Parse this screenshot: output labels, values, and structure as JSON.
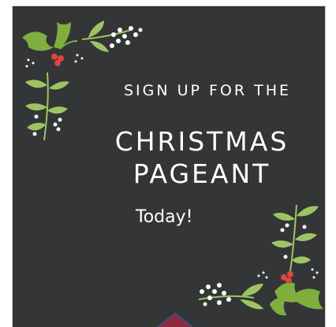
{
  "poster": {
    "kicker": "SIGN UP FOR THE",
    "title_line1": "CHRISTMAS",
    "title_line2": "PAGEANT",
    "subtitle": "Today!"
  },
  "colors": {
    "background": "#333537",
    "text": "#ffffff",
    "leaf_dark": "#7fae3f",
    "leaf_light": "#9dc463",
    "berry": "#d9473e",
    "bottom_shape": "#8c2a3c"
  },
  "icons": [
    "holly-icon",
    "mistletoe-icon",
    "berries-icon",
    "snow-dots-icon"
  ]
}
